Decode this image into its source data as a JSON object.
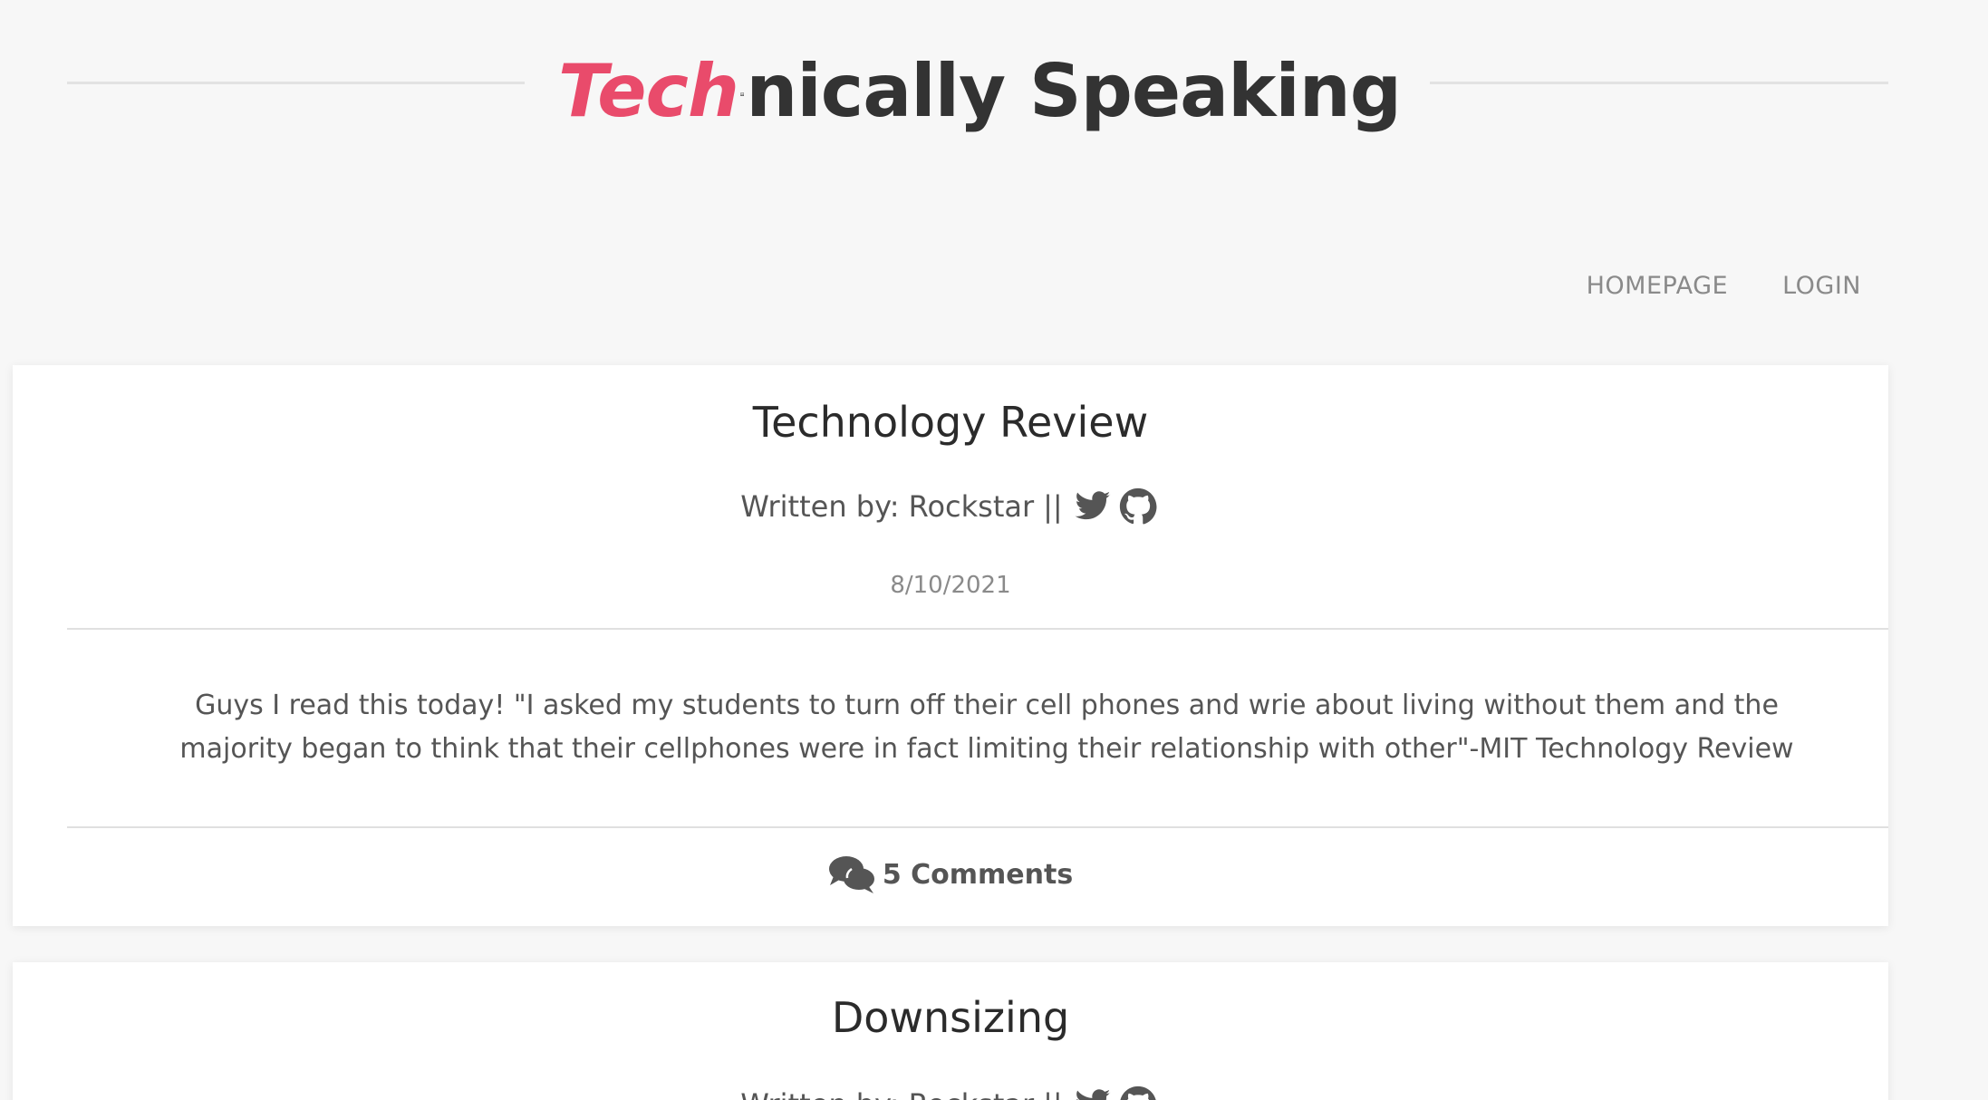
{
  "brand": {
    "tech": "Tech",
    "rest": "nically Speaking",
    "accent_color": "#e94b6b",
    "icon": "laptop-code-icon"
  },
  "nav": {
    "items": [
      {
        "label": "HOMEPAGE"
      },
      {
        "label": "LOGIN"
      }
    ]
  },
  "posts": [
    {
      "title": "Technology Review",
      "author_prefix": "Written by: Rockstar",
      "separator": "||",
      "icons": [
        "twitter-icon",
        "github-icon"
      ],
      "date": "8/10/2021",
      "body": "Guys I read this today! \"I asked my students to turn off their cell phones and wrie about living without them and the majority began to think that their cellphones were in fact limiting their relationship with other\"-MIT Technology Review",
      "comments": "5 Comments",
      "comments_icon": "comments-icon"
    },
    {
      "title": "Downsizing",
      "author_prefix": "Written by: Rockstar",
      "separator": "||",
      "icons": [
        "twitter-icon",
        "github-icon"
      ]
    }
  ]
}
